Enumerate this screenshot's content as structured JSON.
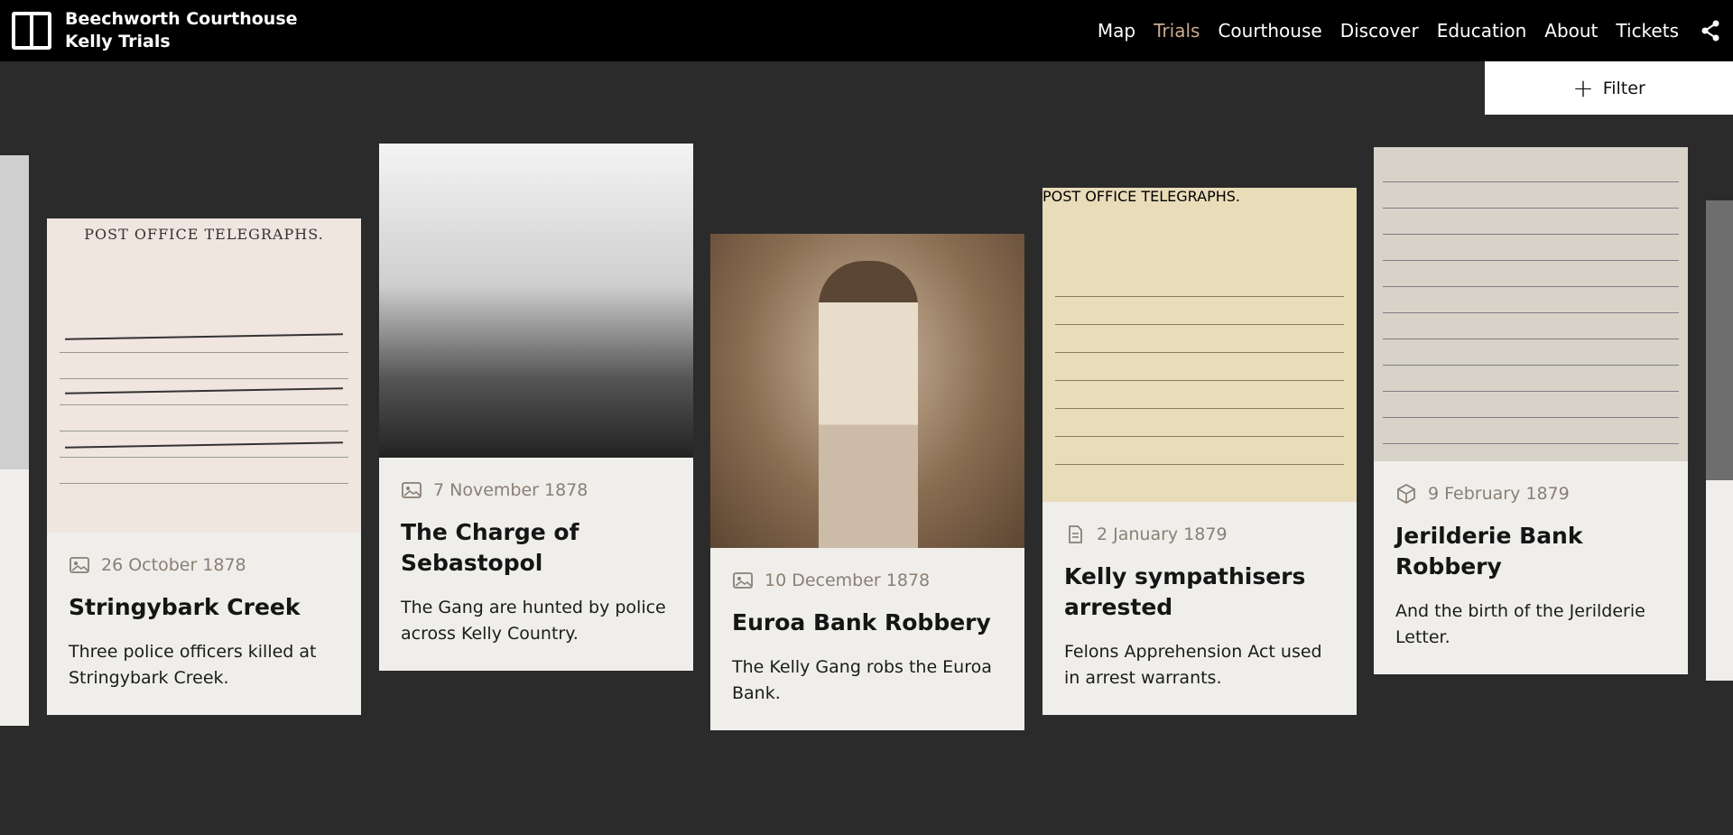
{
  "header": {
    "title_line1": "Beechworth Courthouse",
    "title_line2": "Kelly Trials",
    "nav": [
      "Map",
      "Trials",
      "Courthouse",
      "Discover",
      "Education",
      "About",
      "Tickets"
    ],
    "active_nav": "Trials"
  },
  "filter": {
    "label": "Filter"
  },
  "cards": [
    {
      "date": "26 October 1878",
      "title": "Stringybark Creek",
      "description": "Three police officers killed at Stringybark Creek.",
      "icon": "image-icon",
      "image_heading": "POST OFFICE TELEGRAPHS."
    },
    {
      "date": "7 November 1878",
      "title": "The Charge of Sebastopol",
      "description": "The Gang are hunted by police across Kelly Country.",
      "icon": "image-icon"
    },
    {
      "date": "10 December 1878",
      "title": "Euroa Bank Robbery",
      "description": "The Kelly Gang robs the Euroa Bank.",
      "icon": "image-icon"
    },
    {
      "date": "2 January 1879",
      "title": "Kelly sympathisers arrested",
      "description": "Felons Apprehension Act used in arrest warrants.",
      "icon": "document-icon",
      "image_heading": "POST OFFICE TELEGRAPHS."
    },
    {
      "date": "9 February 1879",
      "title": "Jerilderie Bank Robbery",
      "description": "And the birth of the Jerilderie Letter.",
      "icon": "object-icon"
    }
  ]
}
